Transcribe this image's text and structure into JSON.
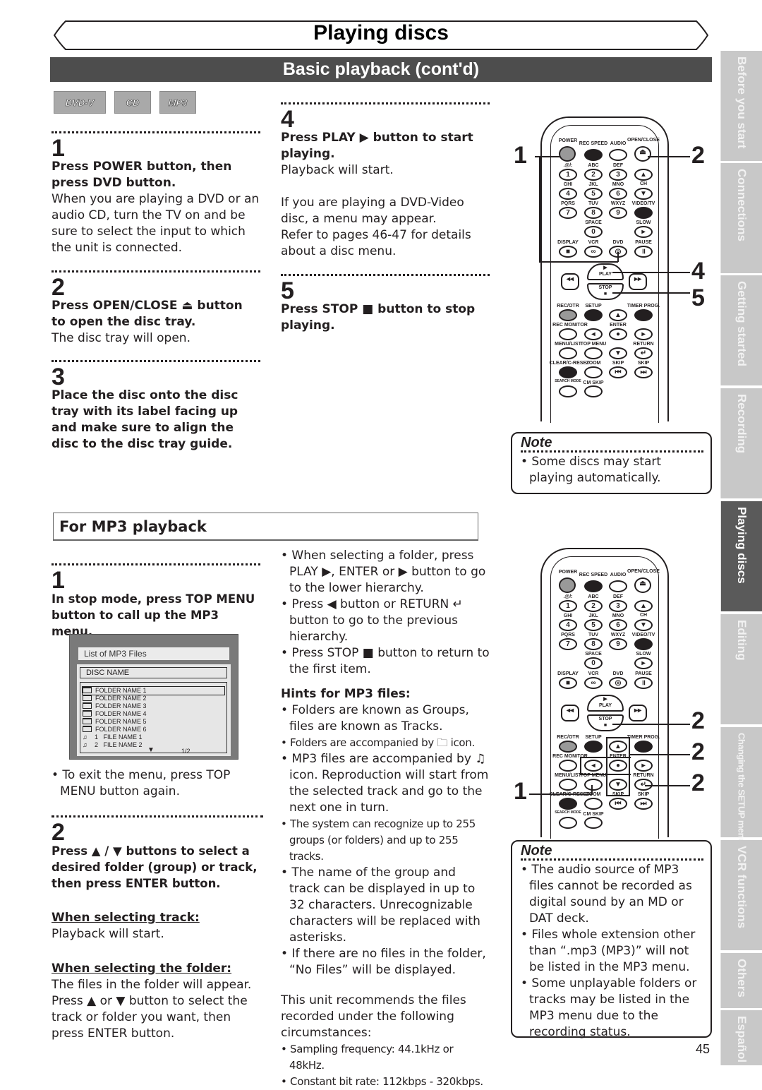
{
  "header": {
    "title": "Playing discs",
    "subtitle": "Basic playback (cont'd)"
  },
  "disc_badges": [
    "DVD-V",
    "CD",
    "MP3"
  ],
  "basic": {
    "step1": {
      "num": "1",
      "bold": "Press POWER button, then press DVD button.",
      "body": "When you are playing a DVD or an audio CD, turn the TV on and be sure to select the input to which the unit is connected."
    },
    "step2": {
      "num": "2",
      "bold": "Press OPEN/CLOSE ⏏ button to open the disc tray.",
      "body": "The disc tray will open."
    },
    "step3": {
      "num": "3",
      "bold": "Place the disc onto the disc tray with its label facing up and make sure to align the disc to the disc tray guide."
    },
    "step4": {
      "num": "4",
      "bold": "Press PLAY ▶ button to start playing.",
      "body1": "Playback will start.",
      "body2": "If you are playing a DVD-Video disc, a menu may appear.",
      "body3": "Refer to pages 46-47 for details about a disc menu."
    },
    "step5": {
      "num": "5",
      "bold": "Press STOP ■ button to stop playing."
    },
    "note": {
      "title": "Note",
      "items": [
        "• Some discs may start playing automatically."
      ]
    }
  },
  "remote": {
    "labels": {
      "power": "POWER",
      "rec_speed": "REC SPEED",
      "audio": "AUDIO",
      "open_close": "OPEN/CLOSE",
      "k1": ".@/:",
      "k2": "ABC",
      "k3": "DEF",
      "k4": "GHI",
      "k5": "JKL",
      "k6": "MNO",
      "k7": "PQRS",
      "k8": "TUV",
      "k9": "WXYZ",
      "k0": "SPACE",
      "ch": "CH",
      "video_tv": "VIDEO/TV",
      "slow": "SLOW",
      "display": "DISPLAY",
      "vcr": "VCR",
      "dvd": "DVD",
      "pause": "PAUSE",
      "play": "PLAY",
      "stop": "STOP",
      "rec_otr": "REC/OTR",
      "setup": "SETUP",
      "timer_prog": "TIMER PROG.",
      "rec_monitor": "REC MONITOR",
      "enter": "ENTER",
      "menu_list": "MENU/LIST",
      "top_menu": "TOP MENU",
      "return": "RETURN",
      "clear_reset": "CLEAR/C-RESET",
      "zoom": "ZOOM",
      "skip": "SKIP",
      "search_mode": "SEARCH MODE",
      "cm_skip": "CM SKIP"
    },
    "digits": [
      "1",
      "2",
      "3",
      "4",
      "5",
      "6",
      "7",
      "8",
      "9",
      "0"
    ],
    "callouts_top": [
      "1",
      "2",
      "4",
      "5"
    ],
    "callouts_bottom": [
      "2",
      "2",
      "2",
      "1"
    ]
  },
  "mp3": {
    "section_title": "For MP3 playback",
    "step1": {
      "num": "1",
      "bold": "In stop mode, press TOP MENU button to call up the MP3 menu."
    },
    "screen": {
      "title": "List of MP3 Files",
      "disc_name": "DISC NAME",
      "rows": [
        "FOLDER NAME 1",
        "FOLDER NAME 2",
        "FOLDER NAME 3",
        "FOLDER NAME 4",
        "FOLDER NAME 5",
        "FOLDER NAME 6"
      ],
      "files": [
        {
          "num": "1",
          "name": "FILE NAME 1"
        },
        {
          "num": "2",
          "name": "FILE NAME 2"
        }
      ],
      "page": "1/2"
    },
    "exit_note": "• To exit the menu, press TOP MENU button again.",
    "step2": {
      "num": "2",
      "bold": "Press ▲ / ▼ buttons to select a desired folder (group) or track, then press ENTER button.",
      "track_head": "When selecting track:",
      "track_body": "Playback will start.",
      "folder_head": "When selecting the folder:",
      "folder_body": "The files in the folder will appear. Press ▲ or ▼ button to select the track or folder you want, then press ENTER button."
    },
    "bullets": [
      "• When selecting a folder, press PLAY ▶, ENTER or ▶ button to go to the lower hierarchy.",
      "• Press ◀ button or RETURN ↵ button to go to the previous hierarchy.",
      "• Press STOP ■ button to return to the first item."
    ],
    "hints_title": "Hints for MP3 files:",
    "hints": [
      "• Folders are known as Groups, files are known as Tracks.",
      "• Folders are accompanied by 🗀 icon.",
      "• MP3 files are accompanied by ♫ icon. Reproduction will start from the selected track and go to the next one in turn.",
      "• The system can recognize up to 255 groups (or folders) and up to 255 tracks.",
      "• The name of the group and track can be displayed in up to 32 characters. Unrecognizable characters will be replaced with asterisks.",
      "• If there are no files in the folder, “No Files” will be displayed."
    ],
    "recommend": "This unit recommends the files recorded under the following circumstances:",
    "specs": [
      "• Sampling frequency: 44.1kHz or 48kHz.",
      "• Constant bit rate: 112kbps - 320kbps."
    ],
    "note": {
      "title": "Note",
      "items": [
        "• The audio source of MP3 files cannot be recorded as digital sound by an MD or DAT deck.",
        "• Files whole extension other than “.mp3 (MP3)” will not be listed in the MP3 menu.",
        "• Some unplayable folders or tracks may be listed in the MP3 menu due to the recording status."
      ]
    }
  },
  "side_tabs": [
    {
      "label": "Before you start",
      "active": false
    },
    {
      "label": "Connections",
      "active": false
    },
    {
      "label": "Getting started",
      "active": false
    },
    {
      "label": "Recording",
      "active": false
    },
    {
      "label": "Playing discs",
      "active": true
    },
    {
      "label": "Editing",
      "active": false
    },
    {
      "label": "Changing the SETUP menu",
      "active": false
    },
    {
      "label": "VCR functions",
      "active": false
    },
    {
      "label": "Others",
      "active": false
    },
    {
      "label": "Español",
      "active": false
    }
  ],
  "page_number": "45"
}
